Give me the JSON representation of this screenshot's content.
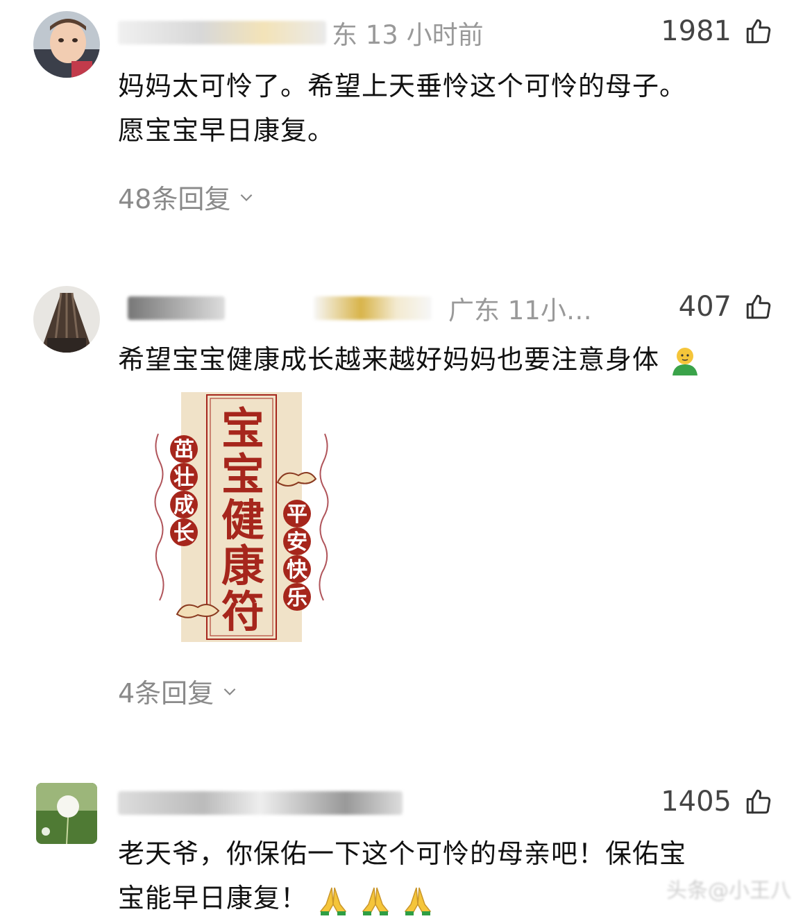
{
  "comments": [
    {
      "location_time": "东 13 小时前",
      "likes": "1981",
      "text_line1": "妈妈太可怜了。希望上天垂怜这个可怜的母子。",
      "text_line2": "愿宝宝早日康复。",
      "replies": "48条回复"
    },
    {
      "location_time": "广东 11小…",
      "likes": "407",
      "text": "希望宝宝健康成长越来越好妈妈也要注意身体",
      "emoji": "green-man-emoji",
      "replies": "4条回复",
      "image": {
        "center": "宝宝健康符",
        "left": "茁壮成长",
        "right": "平安快乐"
      }
    },
    {
      "likes": "1405",
      "text_line1": "老天爷，你保佑一下这个可怜的母亲吧！保佑宝",
      "text_line2": "宝能早日康复！",
      "emoji": "folded-hands-emoji"
    }
  ],
  "colors": {
    "meta": "#999999",
    "text": "#111111",
    "charm_red": "#a6261c",
    "charm_paper": "#f0e2c8"
  },
  "watermark": "头条@小王八"
}
